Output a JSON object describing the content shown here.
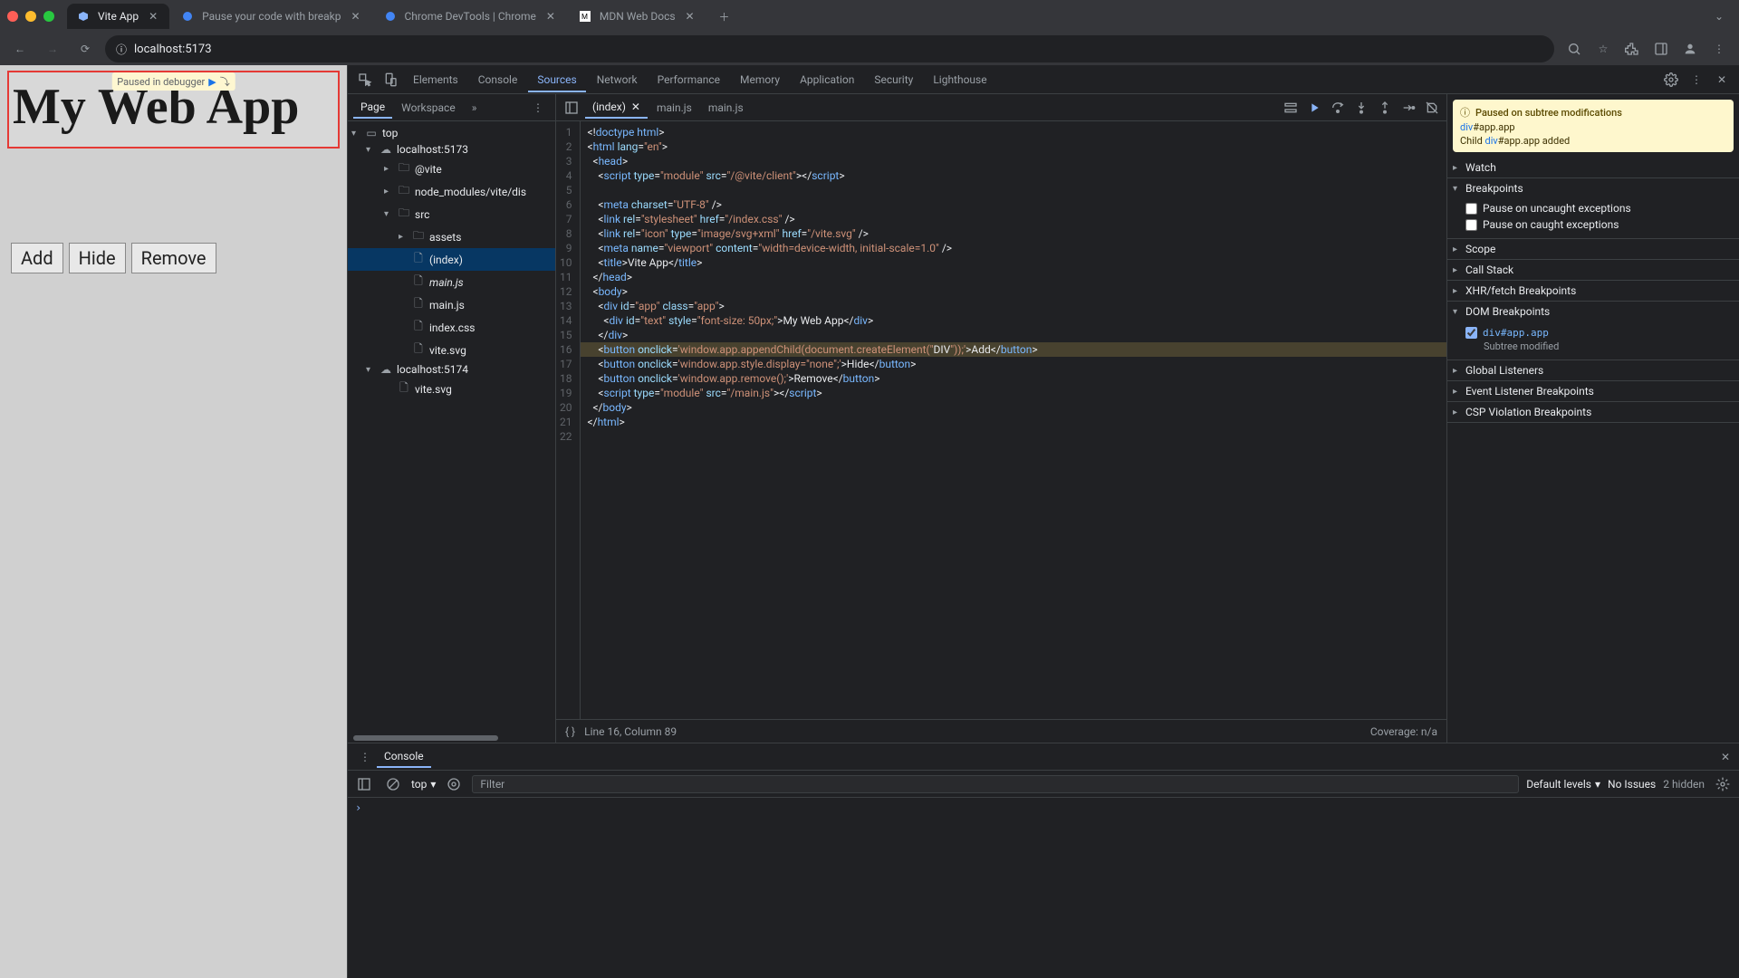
{
  "browser": {
    "tabs": [
      {
        "title": "Vite App",
        "active": true
      },
      {
        "title": "Pause your code with breakp",
        "active": false
      },
      {
        "title": "Chrome DevTools | Chrome",
        "active": false
      },
      {
        "title": "MDN Web Docs",
        "active": false
      }
    ],
    "url": "localhost:5173"
  },
  "page": {
    "paused_label": "Paused in debugger",
    "heading": "My Web App",
    "buttons": {
      "add": "Add",
      "hide": "Hide",
      "remove": "Remove"
    }
  },
  "devtools": {
    "tabs": [
      "Elements",
      "Console",
      "Sources",
      "Network",
      "Performance",
      "Memory",
      "Application",
      "Security",
      "Lighthouse"
    ],
    "active_tab": "Sources",
    "sources_subtabs": [
      "Page",
      "Workspace"
    ],
    "file_tree": {
      "top": "top",
      "host1": "localhost:5173",
      "at_vite": "@vite",
      "node_modules": "node_modules/vite/dis",
      "src": "src",
      "assets": "assets",
      "index": "(index)",
      "mainjs_i": "main.js",
      "mainjs": "main.js",
      "indexcss": "index.css",
      "vitesvg": "vite.svg",
      "host2": "localhost:5174",
      "vitesvg2": "vite.svg"
    },
    "editor_tabs": [
      {
        "label": "(index)",
        "active": true,
        "closeable": true
      },
      {
        "label": "main.js",
        "active": false,
        "closeable": false
      },
      {
        "label": "main.js",
        "active": false,
        "closeable": false
      }
    ],
    "status": {
      "cursor": "Line 16, Column 89",
      "coverage": "Coverage: n/a"
    },
    "code": {
      "line_count": 22,
      "highlighted_line": 16
    },
    "pause_banner": {
      "title": "Paused on subtree modifications",
      "line_a_pre": "div",
      "line_a_sel": "#app.app",
      "line_b_pre": "Child ",
      "line_b_kw": "div",
      "line_b_sel": "#app.app",
      "line_b_post": " added"
    },
    "debugger": {
      "watch": "Watch",
      "breakpoints": "Breakpoints",
      "bp_uncaught": "Pause on uncaught exceptions",
      "bp_caught": "Pause on caught exceptions",
      "scope": "Scope",
      "callstack": "Call Stack",
      "xhr": "XHR/fetch Breakpoints",
      "dom_bp": "DOM Breakpoints",
      "dom_item_sel": "div#app.app",
      "dom_item_sub": "Subtree modified",
      "global": "Global Listeners",
      "evt": "Event Listener Breakpoints",
      "csp": "CSP Violation Breakpoints"
    }
  },
  "console": {
    "tab": "Console",
    "context": "top",
    "filter_placeholder": "Filter",
    "levels": "Default levels",
    "issues": "No Issues",
    "hidden": "2 hidden"
  }
}
